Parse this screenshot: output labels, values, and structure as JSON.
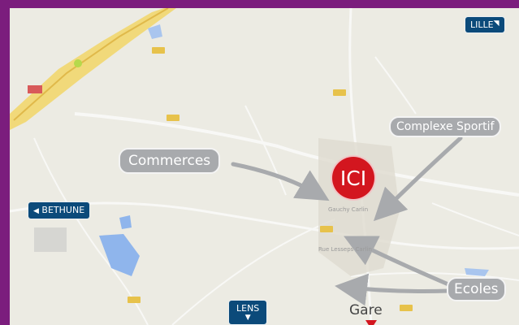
{
  "map": {
    "marker": {
      "label": "ICI"
    },
    "station": {
      "label": "Gare"
    },
    "destinations": {
      "lille": "LILLE",
      "bethune": "BETHUNE",
      "lens": "LENS"
    },
    "callouts": {
      "commerces": "Commerces",
      "complexe_sportif": "Complexe Sportif",
      "ecoles": "Ecoles"
    },
    "map_labels": {
      "town": "Gauchy Carlin",
      "road1": "Rue Lesseps Carlin"
    },
    "colors": {
      "frame": "#7b1d7d",
      "ici_marker": "#d3161f",
      "destination_badge": "#0b4a7a",
      "callout": "#a8aaad"
    }
  }
}
